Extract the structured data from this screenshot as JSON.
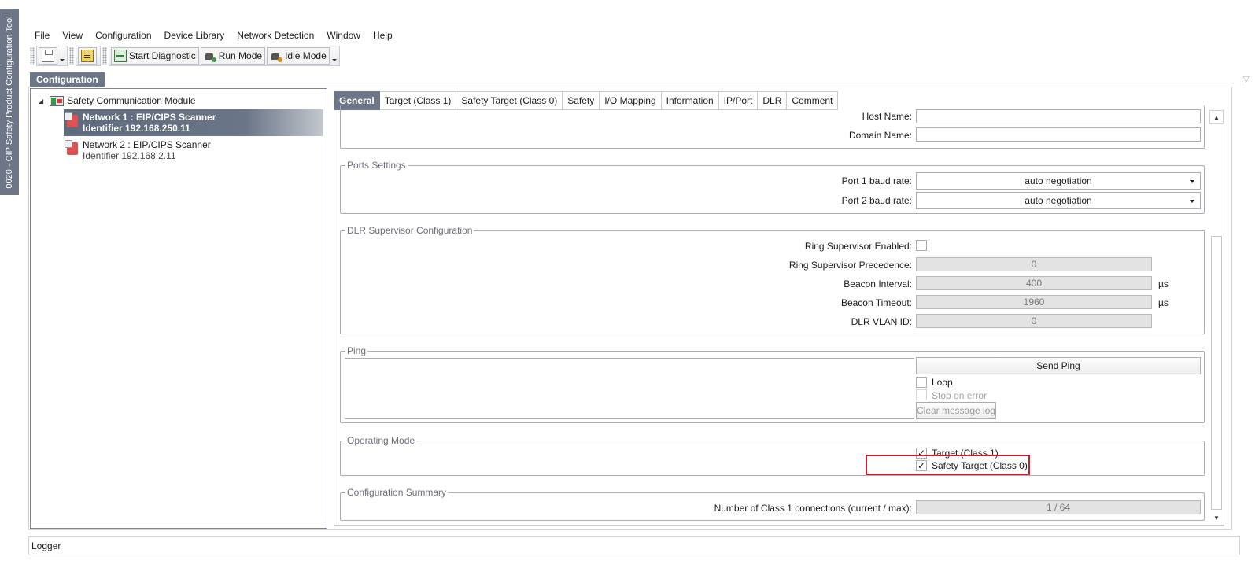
{
  "side_tab": {
    "title": "0020 - CIP Safety Product Configuration Tool"
  },
  "menu": [
    "File",
    "View",
    "Configuration",
    "Device Library",
    "Network Detection",
    "Window",
    "Help"
  ],
  "toolbar": {
    "start_diagnostic": "Start Diagnostic",
    "run_mode": "Run Mode",
    "idle_mode": "Idle Mode"
  },
  "config_tab": {
    "label": "Configuration"
  },
  "tree": {
    "root": "Safety Communication Module",
    "nodes": [
      {
        "line1": "Network 1 : EIP/CIPS Scanner",
        "line2": "Identifier 192.168.250.11",
        "selected": true
      },
      {
        "line1": "Network 2 : EIP/CIPS Scanner",
        "line2": "Identifier 192.168.2.11",
        "selected": false
      }
    ]
  },
  "tabs": [
    "General",
    "Target (Class 1)",
    "Safety Target (Class 0)",
    "Safety",
    "I/O Mapping",
    "Information",
    "IP/Port",
    "DLR",
    "Comment"
  ],
  "network": {
    "host_name_label": "Host Name:",
    "host_name_value": "",
    "domain_name_label": "Domain Name:",
    "domain_name_value": ""
  },
  "ports": {
    "title": "Ports Settings",
    "port1_label": "Port 1 baud rate:",
    "port1_value": "auto negotiation",
    "port2_label": "Port 2 baud rate:",
    "port2_value": "auto negotiation"
  },
  "dlr": {
    "title": "DLR Supervisor Configuration",
    "ring_enabled_label": "Ring Supervisor Enabled:",
    "ring_enabled_checked": false,
    "precedence_label": "Ring Supervisor Precedence:",
    "precedence_value": "0",
    "beacon_interval_label": "Beacon Interval:",
    "beacon_interval_value": "400",
    "beacon_interval_unit": "µs",
    "beacon_timeout_label": "Beacon Timeout:",
    "beacon_timeout_value": "1960",
    "beacon_timeout_unit": "µs",
    "vlan_label": "DLR VLAN ID:",
    "vlan_value": "0"
  },
  "ping": {
    "title": "Ping",
    "send_label": "Send Ping",
    "loop_label": "Loop",
    "stop_on_error_label": "Stop on error",
    "clear_label": "Clear message log"
  },
  "operating_mode": {
    "title": "Operating Mode",
    "target_class1_label": "Target (Class 1)",
    "target_class1_checked": true,
    "safety_target_label": "Safety Target (Class 0)",
    "safety_target_checked": true
  },
  "summary": {
    "title": "Configuration Summary",
    "connections_label": "Number of Class 1 connections (current / max):",
    "connections_value": "1 / 64"
  },
  "logger": {
    "label": "Logger"
  },
  "colors": {
    "accent": "#6c7687",
    "highlight": "#c8202a"
  }
}
